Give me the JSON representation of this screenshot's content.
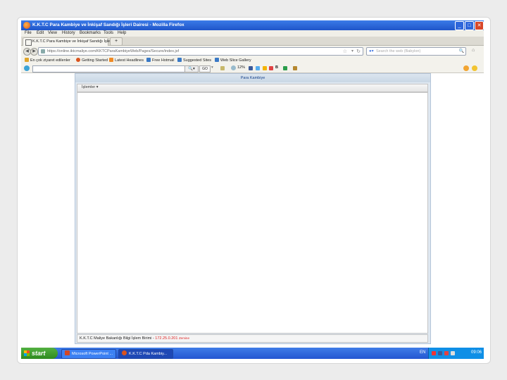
{
  "window": {
    "title": "K.K.T.C Para Kambiye ve İnkişaf Sandığı İşleri Dairesi - Mozilla Firefox",
    "buttons": [
      "_",
      "□",
      "✕"
    ]
  },
  "menu": [
    "File",
    "Edit",
    "View",
    "History",
    "Bookmarks",
    "Tools",
    "Help"
  ],
  "tab": {
    "label": "K.K.T.C Para Kambiye ve İnkişaf Sandığı İşle",
    "new_tab": "+"
  },
  "nav": {
    "back": "◀",
    "forward": "▶",
    "url": "https://online.iktcmaliye.com/KKTCParaKambiyeWeb/Pages/Secure/index.jsf",
    "search_placeholder": "Search the web (Babylon)"
  },
  "bookmarks": [
    {
      "label": "En çok ziyaret edilenler",
      "icon": "folder-icon",
      "color": "#e0a52a"
    },
    {
      "label": "Getting Started",
      "icon": "firefox-icon",
      "color": "#d9531e"
    },
    {
      "label": "Latest Headlines",
      "icon": "rss-icon",
      "color": "#f08a24"
    },
    {
      "label": "Free Hotmail",
      "icon": "hotmail-icon",
      "color": "#3a79c6"
    },
    {
      "label": "Suggested Sites",
      "icon": "ie-icon",
      "color": "#3a79c6"
    },
    {
      "label": "Web Slice Gallery",
      "icon": "slice-icon",
      "color": "#3a79c6"
    }
  ],
  "toolbar": {
    "go_label": "GO",
    "zoom": "12%"
  },
  "app": {
    "title": "Para Kambiye",
    "menu": "İşlemler ▾",
    "status_text": "K.K.T.C Maliye Bakanlığı Bilgi İşlem Birimi - ",
    "status_ip": "172.25.0.201",
    "status_extra": "Zemine"
  },
  "taskbar": {
    "start": "start",
    "tasks": [
      {
        "label": "Microsoft PowerPoint ...",
        "color": "#d24726"
      },
      {
        "label": "K.K.T.C Pda Kambiy...",
        "color": "#d9531e"
      }
    ],
    "lang": "EN",
    "clock": "09:06"
  }
}
